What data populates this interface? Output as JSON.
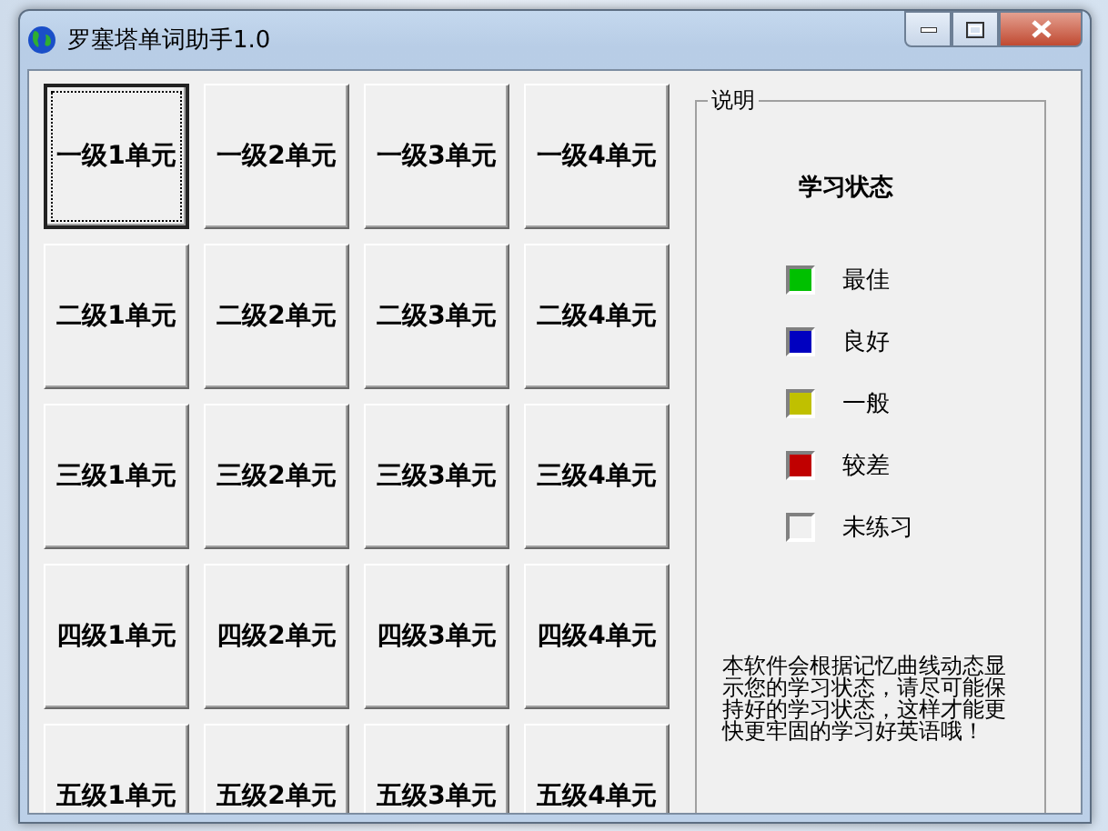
{
  "window": {
    "title": "罗塞塔单词助手1.0"
  },
  "units": [
    [
      {
        "label": "一级1单元",
        "focused": true
      },
      {
        "label": "一级2单元",
        "focused": false
      },
      {
        "label": "一级3单元",
        "focused": false
      },
      {
        "label": "一级4单元",
        "focused": false
      }
    ],
    [
      {
        "label": "二级1单元",
        "focused": false
      },
      {
        "label": "二级2单元",
        "focused": false
      },
      {
        "label": "二级3单元",
        "focused": false
      },
      {
        "label": "二级4单元",
        "focused": false
      }
    ],
    [
      {
        "label": "三级1单元",
        "focused": false
      },
      {
        "label": "三级2单元",
        "focused": false
      },
      {
        "label": "三级3单元",
        "focused": false
      },
      {
        "label": "三级4单元",
        "focused": false
      }
    ],
    [
      {
        "label": "四级1单元",
        "focused": false
      },
      {
        "label": "四级2单元",
        "focused": false
      },
      {
        "label": "四级3单元",
        "focused": false
      },
      {
        "label": "四级4单元",
        "focused": false
      }
    ],
    [
      {
        "label": "五级1单元",
        "focused": false
      },
      {
        "label": "五级2单元",
        "focused": false
      },
      {
        "label": "五级3单元",
        "focused": false
      },
      {
        "label": "五级4单元",
        "focused": false
      }
    ]
  ],
  "legend_panel": {
    "title": "说明",
    "heading": "学习状态",
    "items": [
      {
        "label": "最佳",
        "color": "#00c000"
      },
      {
        "label": "良好",
        "color": "#0000c0"
      },
      {
        "label": "一般",
        "color": "#c0c000"
      },
      {
        "label": "较差",
        "color": "#c00000"
      },
      {
        "label": "未练习",
        "color": "#f0f0f0"
      }
    ],
    "description": "本软件会根据记忆曲线动态显示您的学习状态，请尽可能保持好的学习状态，这样才能更快更牢固的学习好英语哦！"
  }
}
